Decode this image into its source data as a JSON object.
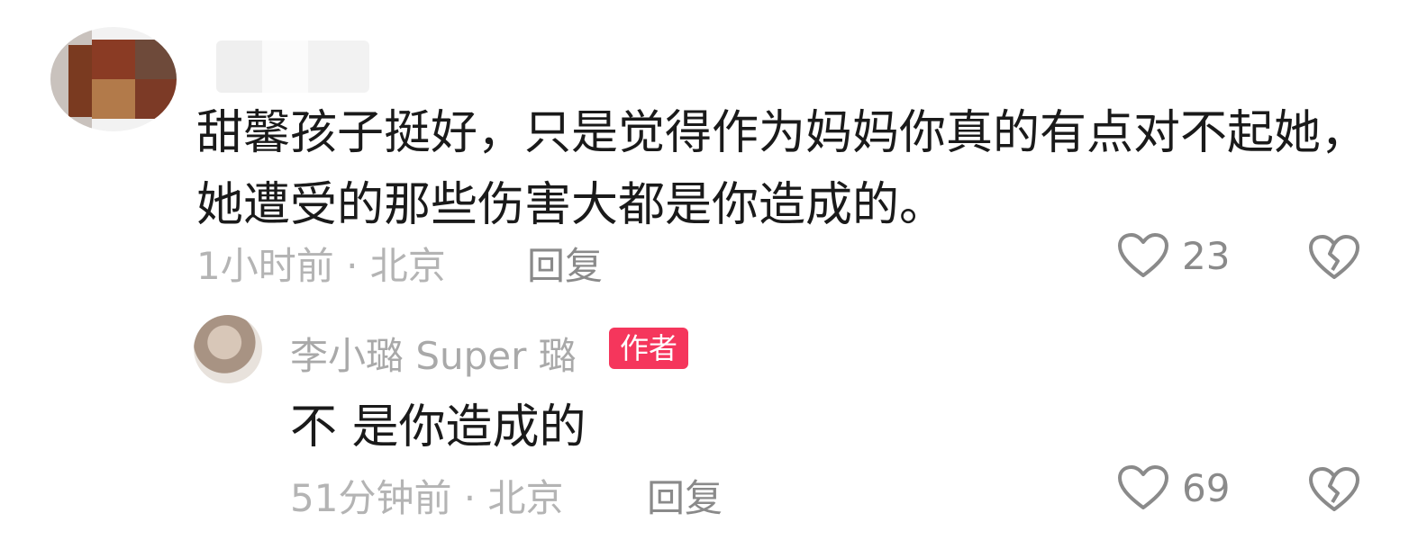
{
  "comment": {
    "text": "甜馨孩子挺好，只是觉得作为妈妈你真的有点对不起她，她遭受的那些伤害大都是你造成的。",
    "meta": "1小时前 · 北京",
    "reply_label": "回复",
    "likes": "23"
  },
  "reply": {
    "username": "李小璐 Super 璐",
    "badge": "作者",
    "text": "不 是你造成的",
    "meta": "51分钟前 · 北京",
    "reply_label": "回复",
    "likes": "69"
  },
  "icons": {
    "like": "heart-outline-icon",
    "dislike": "broken-heart-icon"
  },
  "colors": {
    "badge": "#f5365c",
    "meta": "#b4b4b4",
    "text": "#1a1a1a"
  }
}
